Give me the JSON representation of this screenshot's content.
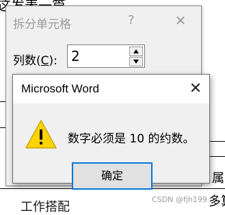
{
  "background_document": {
    "top_fragment": "这发表一篇",
    "right_fragment_1": "属",
    "right_fragment_2": "多算",
    "bottom_fragment": "工作搭配"
  },
  "split_dialog": {
    "title": "拆分单元格",
    "help": "?",
    "close": "✕",
    "columns_label_prefix": "列数(",
    "columns_label_key": "C",
    "columns_label_suffix": "):",
    "columns_value": "2"
  },
  "alert": {
    "title": "Microsoft Word",
    "close": "✕",
    "message": "数字必须是 10 的约数。",
    "ok_label": "确定"
  },
  "watermark": "CSDN @fjh199"
}
